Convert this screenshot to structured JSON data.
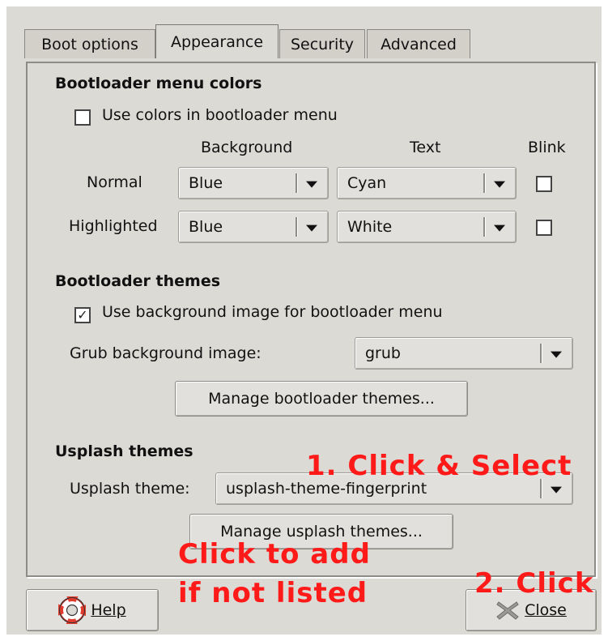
{
  "tabs": [
    {
      "label": "Boot options",
      "active": false
    },
    {
      "label": "Appearance",
      "active": true
    },
    {
      "label": "Security",
      "active": false
    },
    {
      "label": "Advanced",
      "active": false
    }
  ],
  "menu_colors": {
    "title": "Bootloader menu colors",
    "use_colors_label": "Use colors in bootloader menu",
    "use_colors_checked": false,
    "col_background": "Background",
    "col_text": "Text",
    "col_blink": "Blink",
    "rows": [
      {
        "label": "Normal",
        "background": "Blue",
        "text": "Cyan",
        "blink": false
      },
      {
        "label": "Highlighted",
        "background": "Blue",
        "text": "White",
        "blink": false
      }
    ]
  },
  "themes": {
    "title": "Bootloader themes",
    "use_bg_label": "Use background image for bootloader menu",
    "use_bg_checked": true,
    "check_glyph": "✓",
    "grub_label": "Grub background image:",
    "grub_value": "grub",
    "manage_label": "Manage bootloader themes..."
  },
  "usplash": {
    "title": "Usplash themes",
    "theme_label": "Usplash theme:",
    "theme_value": "usplash-theme-fingerprint",
    "manage_label": "Manage usplash themes..."
  },
  "footer": {
    "help_label": "Help",
    "help_icon": "lifebuoy-icon",
    "close_label": "Close",
    "close_icon": "close-x-icon"
  },
  "annotations": {
    "click_select": "1. Click & Select",
    "click_add_1": "Click to add",
    "click_add_2": "if not listed",
    "click_close": "2. Click",
    "color": "#ff1a1a"
  }
}
